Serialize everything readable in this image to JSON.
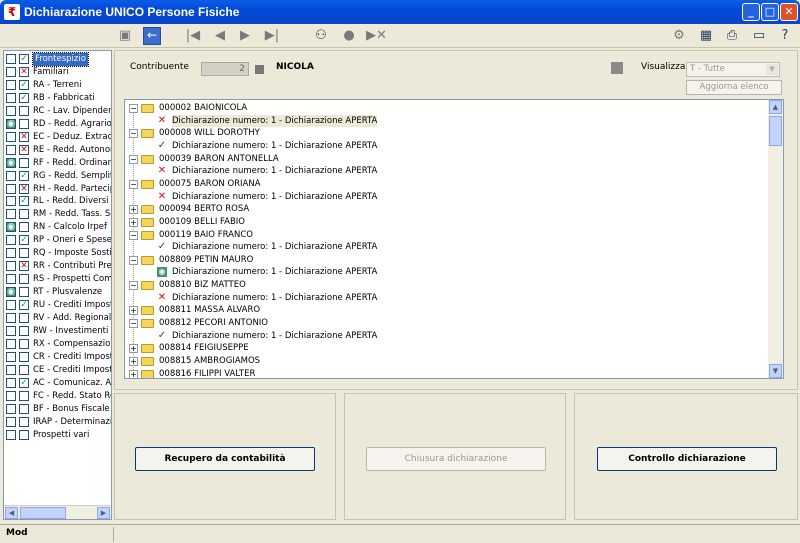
{
  "window": {
    "title": "Dichiarazione UNICO Persone Fisiche",
    "app_icon": "app-icon"
  },
  "toolbar": {
    "left_icons": [
      "save-icon",
      "back-icon"
    ],
    "nav_icons": [
      "first-icon",
      "prev-icon",
      "next-icon",
      "last-icon",
      "binoculars-icon",
      "circle-icon",
      "skip-icon"
    ],
    "right_icons": [
      "gear-icon",
      "calculator-icon",
      "print-icon",
      "monitor-icon",
      "help-icon"
    ]
  },
  "sidebar": {
    "items": [
      {
        "label": "Frontespizio",
        "c1": "empty",
        "c2": "check",
        "selected": true
      },
      {
        "label": "Familiari",
        "c1": "empty",
        "c2": "cross"
      },
      {
        "label": "RA - Terreni",
        "c1": "empty",
        "c2": "check"
      },
      {
        "label": "RB - Fabbricati",
        "c1": "empty",
        "c2": "check"
      },
      {
        "label": "RC - Lav. Dipendenti",
        "c1": "empty",
        "c2": "empty"
      },
      {
        "label": "RD - Redd. Agrario",
        "c1": "green",
        "c2": "empty"
      },
      {
        "label": "EC - Deduz. Extracontabili",
        "c1": "empty",
        "c2": "cross"
      },
      {
        "label": "RE - Redd. Autonomi",
        "c1": "empty",
        "c2": "cross"
      },
      {
        "label": "RF - Redd. Ordinario",
        "c1": "green",
        "c2": "empty"
      },
      {
        "label": "RG - Redd. Semplificato",
        "c1": "empty",
        "c2": "check"
      },
      {
        "label": "RH - Redd. Partecipazione",
        "c1": "empty",
        "c2": "cross"
      },
      {
        "label": "RL - Redd. Diversi",
        "c1": "empty",
        "c2": "check"
      },
      {
        "label": "RM - Redd. Tass. Separata",
        "c1": "empty",
        "c2": "empty"
      },
      {
        "label": "RN - Calcolo Irpef",
        "c1": "green",
        "c2": "empty"
      },
      {
        "label": "RP - Oneri e Spese",
        "c1": "empty",
        "c2": "check"
      },
      {
        "label": "RQ - Imposte Sostitutive",
        "c1": "empty",
        "c2": "empty"
      },
      {
        "label": "RR - Contributi Previdenziali",
        "c1": "empty",
        "c2": "cross"
      },
      {
        "label": "RS - Prospetti Comuni",
        "c1": "empty",
        "c2": "empty"
      },
      {
        "label": "RT - Plusvalenze",
        "c1": "green",
        "c2": "empty"
      },
      {
        "label": "RU - Crediti Imposte",
        "c1": "empty",
        "c2": "check"
      },
      {
        "label": "RV - Add. Regionale",
        "c1": "empty",
        "c2": "empty"
      },
      {
        "label": "RW - Investimenti all'estero",
        "c1": "empty",
        "c2": "empty"
      },
      {
        "label": "RX - Compensazioni",
        "c1": "empty",
        "c2": "empty"
      },
      {
        "label": "CR - Crediti Imposte",
        "c1": "empty",
        "c2": "empty"
      },
      {
        "label": "CE - Crediti Imposte",
        "c1": "empty",
        "c2": "empty"
      },
      {
        "label": "AC - Comunicaz. Amministratori",
        "c1": "empty",
        "c2": "check"
      },
      {
        "label": "FC - Redd. Stato Residenza",
        "c1": "empty",
        "c2": "empty"
      },
      {
        "label": "BF - Bonus Fiscale",
        "c1": "empty",
        "c2": "empty"
      },
      {
        "label": "IRAP - Determinazione",
        "c1": "empty",
        "c2": "empty"
      },
      {
        "label": "Prospetti vari",
        "c1": "empty",
        "c2": "empty"
      }
    ]
  },
  "header": {
    "contribuente_label": "Contribuente",
    "contribuente_code": "2",
    "contribuente_name": "NICOLA",
    "visualizza_label": "Visualizza",
    "visualizza_value": "T  - Tutte",
    "refresh_label": "Aggiorna elenco"
  },
  "tree": [
    {
      "type": "person",
      "name": "000002 BAIONICOLA",
      "expanded": true
    },
    {
      "type": "decl",
      "text": "Dichiarazione numero: 1 - Dichiarazione APERTA",
      "icon": "red",
      "highlight": true
    },
    {
      "type": "person",
      "name": "000008 WILL DOROTHY",
      "expanded": true
    },
    {
      "type": "decl",
      "text": "Dichiarazione numero: 1 - Dichiarazione APERTA",
      "icon": "blue"
    },
    {
      "type": "person",
      "name": "000039 BARON ANTONELLA",
      "expanded": true
    },
    {
      "type": "decl",
      "text": "Dichiarazione numero: 1 - Dichiarazione APERTA",
      "icon": "red"
    },
    {
      "type": "person",
      "name": "000075 BARON ORIANA",
      "expanded": true
    },
    {
      "type": "decl",
      "text": "Dichiarazione numero: 1 - Dichiarazione APERTA",
      "icon": "red"
    },
    {
      "type": "person",
      "name": "000094 BERTO ROSA",
      "expanded": false
    },
    {
      "type": "person",
      "name": "000109 BELLI FABIO",
      "expanded": false
    },
    {
      "type": "person",
      "name": "000119 BAIO FRANCO",
      "expanded": true
    },
    {
      "type": "decl",
      "text": "Dichiarazione numero: 1 - Dichiarazione APERTA",
      "icon": "blue"
    },
    {
      "type": "person",
      "name": "008809 PETIN MAURO",
      "expanded": true
    },
    {
      "type": "decl",
      "text": "Dichiarazione numero: 1 - Dichiarazione APERTA",
      "icon": "green"
    },
    {
      "type": "person",
      "name": "008810 BIZ MATTEO",
      "expanded": true
    },
    {
      "type": "decl",
      "text": "Dichiarazione numero: 1 - Dichiarazione APERTA",
      "icon": "red"
    },
    {
      "type": "person",
      "name": "008811 MASSA ALVARO",
      "expanded": false
    },
    {
      "type": "person",
      "name": "008812 PECORI ANTONIO",
      "expanded": true
    },
    {
      "type": "decl",
      "text": "Dichiarazione numero: 1 - Dichiarazione APERTA",
      "icon": "blue"
    },
    {
      "type": "person",
      "name": "008814 FEIGIUSEPPE",
      "expanded": false
    },
    {
      "type": "person",
      "name": "008815 AMBROGIAMOS",
      "expanded": false
    },
    {
      "type": "person",
      "name": "008816 FILIPPI VALTER",
      "expanded": false
    }
  ],
  "buttons": {
    "recupero": "Recupero da contabilità",
    "chiusura": "Chiusura dichiarazione",
    "controllo": "Controllo dichiarazione"
  },
  "status": {
    "mode": "Mod"
  }
}
